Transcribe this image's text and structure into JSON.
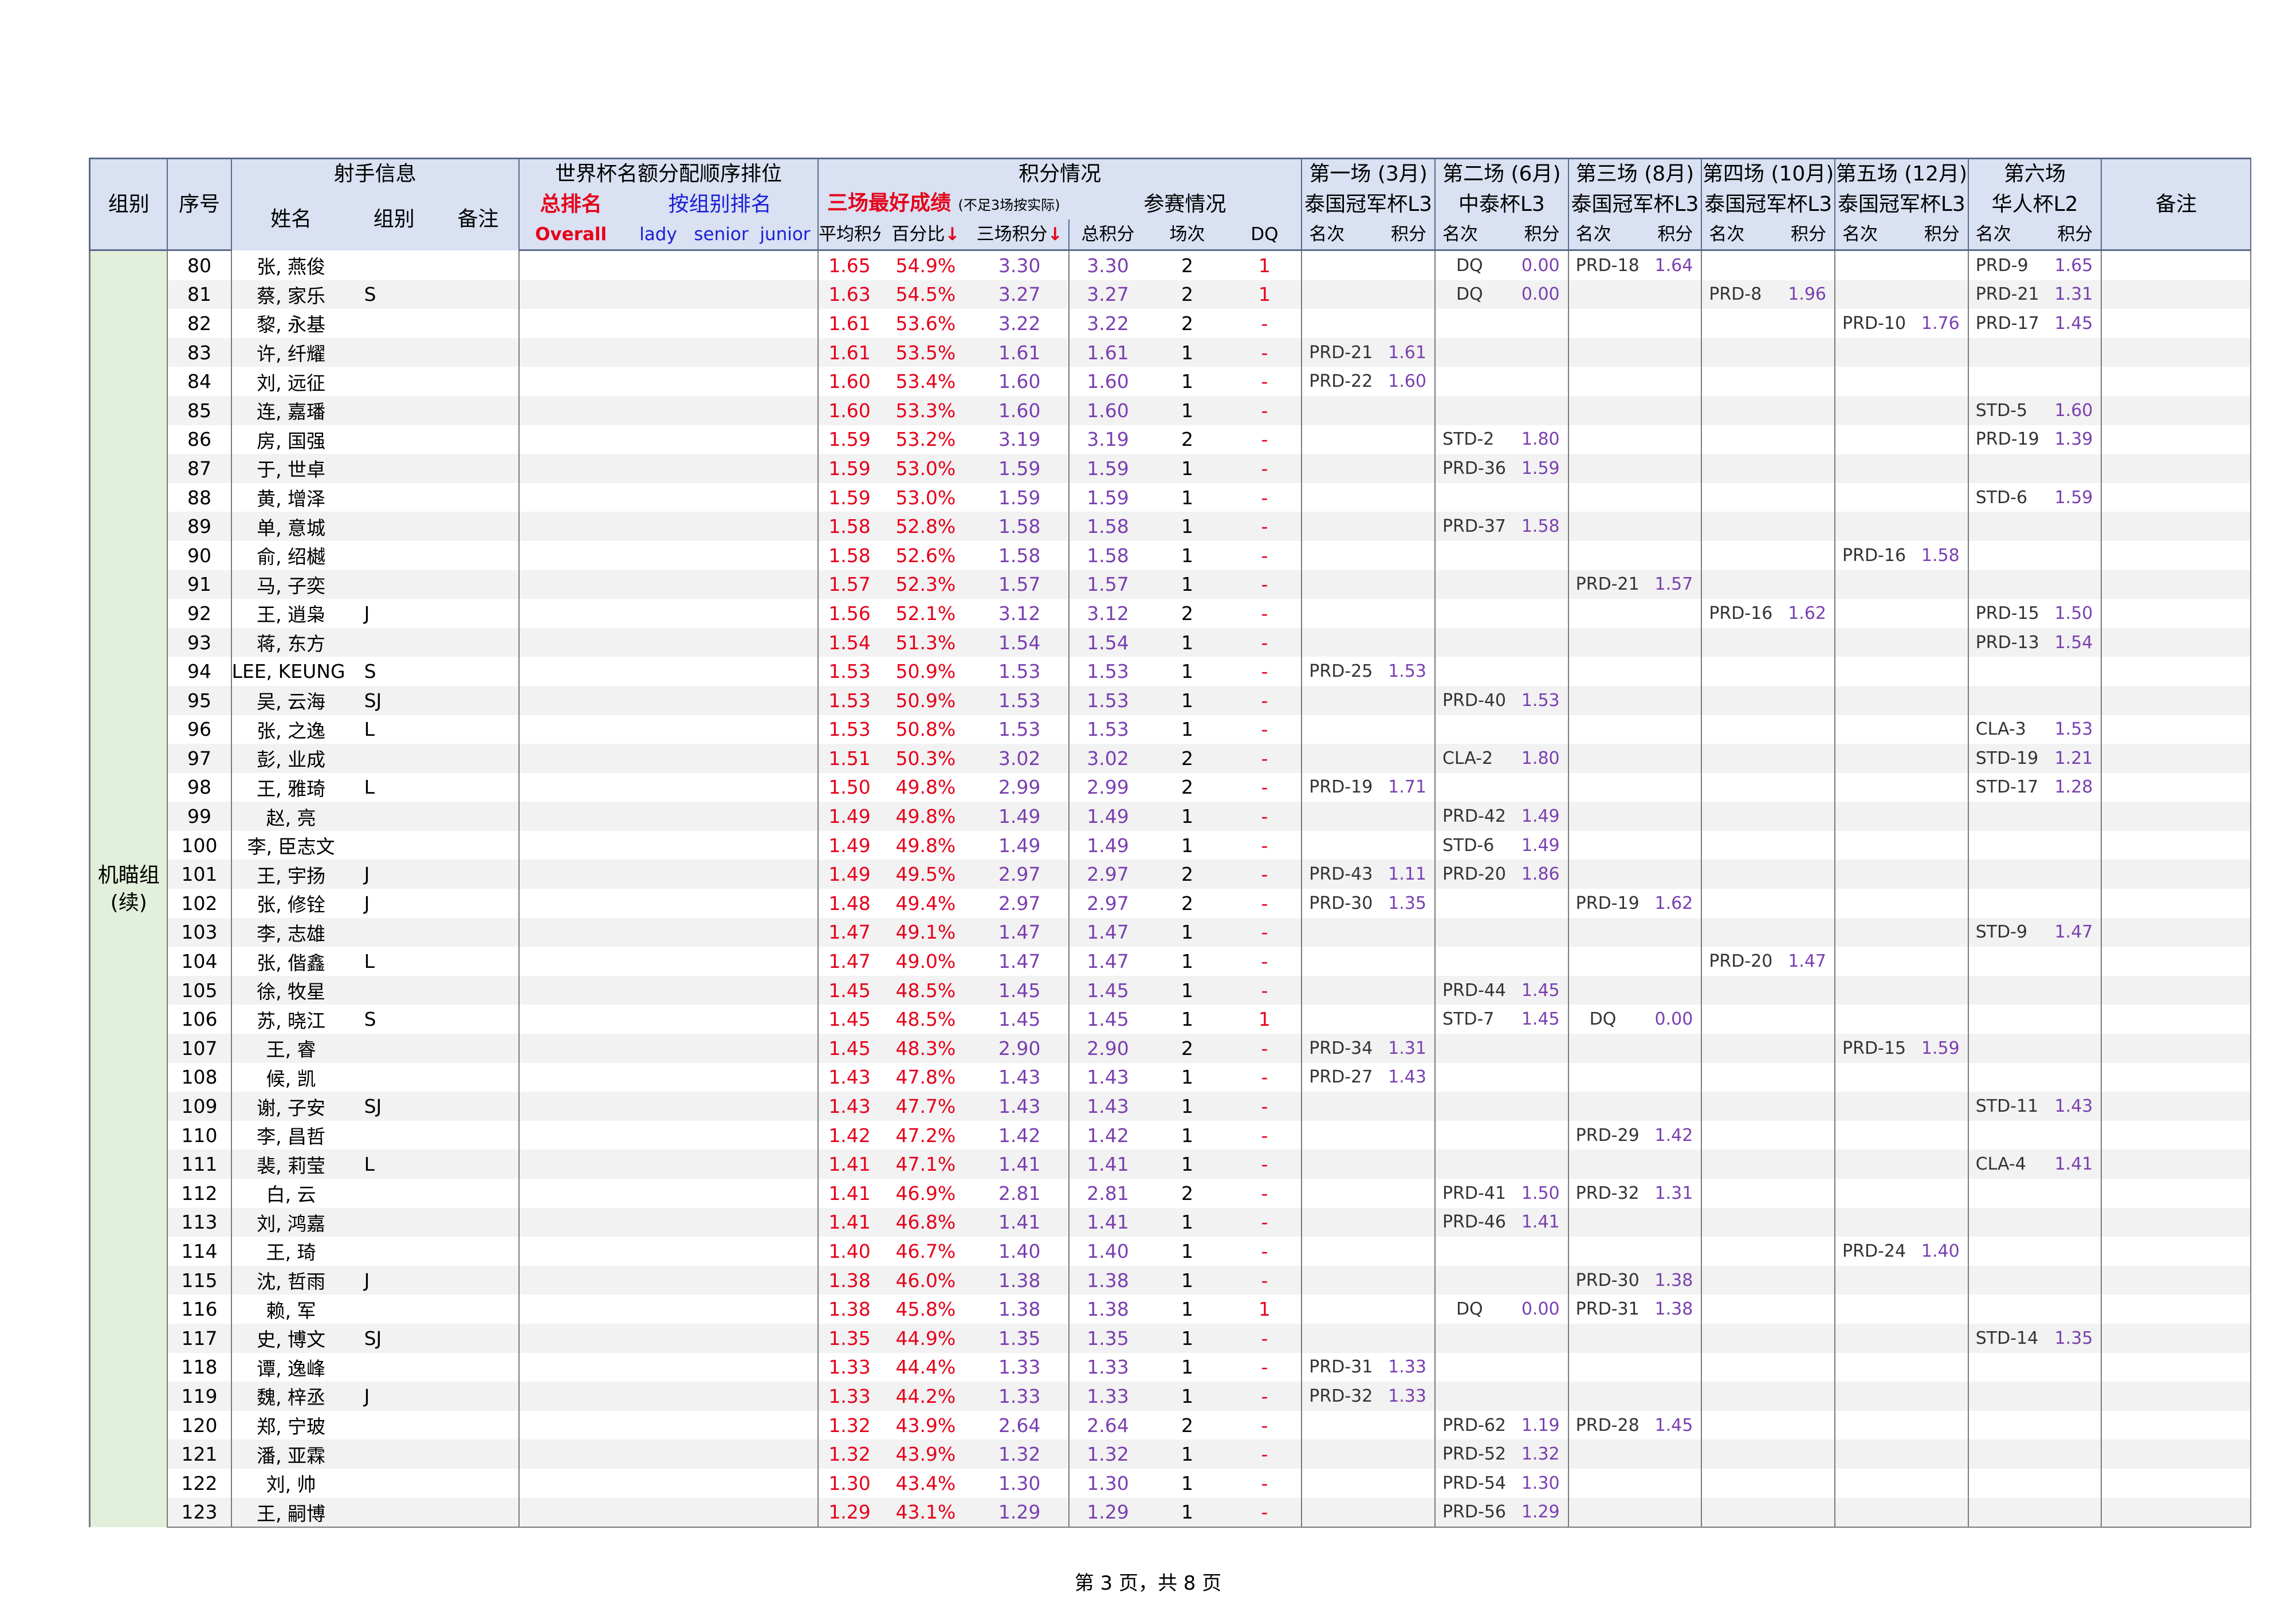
{
  "header": {
    "group": "组别",
    "seq": "序号",
    "shooter_info": "射手信息",
    "name": "姓名",
    "category": "组别",
    "remark_small": "备注",
    "wc_title": "世界杯名额分配顺序排位",
    "overall_cn": "总排名",
    "overall_en": "Overall",
    "by_group": "按组别排名",
    "lady": "lady",
    "senior": "senior",
    "junior": "junior",
    "score_title": "积分情况",
    "best3": "三场最好成绩",
    "best3_note": "(不足3场按实际)",
    "avg": "平均积分",
    "pct": "百分比",
    "three": "三场积分",
    "arrow": "↓",
    "participation": "参赛情况",
    "total": "总积分",
    "count": "场次",
    "dq": "DQ",
    "rank": "名次",
    "pts": "积分",
    "remark": "备注",
    "events": [
      {
        "title": "第一场 (3月)",
        "name": "泰国冠军杯L3"
      },
      {
        "title": "第二场 (6月)",
        "name": "中泰杯L3"
      },
      {
        "title": "第三场 (8月)",
        "name": "泰国冠军杯L3"
      },
      {
        "title": "第四场 (10月)",
        "name": "泰国冠军杯L3"
      },
      {
        "title": "第五场 (12月)",
        "name": "泰国冠军杯L3"
      },
      {
        "title": "第六场",
        "name": "华人杯L2"
      }
    ]
  },
  "group_label": "机瞄组 (续)",
  "rows": [
    {
      "no": "80",
      "name": "张, 燕俊",
      "tag": "",
      "avg": "1.65",
      "pct": "54.9%",
      "three": "3.30",
      "total": "3.30",
      "n": "2",
      "dq": "1",
      "e": [
        null,
        [
          "DQ",
          "0.00"
        ],
        [
          "PRD-18",
          "1.64"
        ],
        null,
        null,
        [
          "PRD-9",
          "1.65"
        ]
      ]
    },
    {
      "no": "81",
      "name": "蔡, 家乐",
      "tag": "S",
      "avg": "1.63",
      "pct": "54.5%",
      "three": "3.27",
      "total": "3.27",
      "n": "2",
      "dq": "1",
      "e": [
        null,
        [
          "DQ",
          "0.00"
        ],
        null,
        [
          "PRD-8",
          "1.96"
        ],
        null,
        [
          "PRD-21",
          "1.31"
        ]
      ]
    },
    {
      "no": "82",
      "name": "黎, 永基",
      "tag": "",
      "avg": "1.61",
      "pct": "53.6%",
      "three": "3.22",
      "total": "3.22",
      "n": "2",
      "dq": "-",
      "e": [
        null,
        null,
        null,
        null,
        [
          "PRD-10",
          "1.76"
        ],
        [
          "PRD-17",
          "1.45"
        ]
      ]
    },
    {
      "no": "83",
      "name": "许, 纤耀",
      "tag": "",
      "avg": "1.61",
      "pct": "53.5%",
      "three": "1.61",
      "total": "1.61",
      "n": "1",
      "dq": "-",
      "e": [
        [
          "PRD-21",
          "1.61"
        ],
        null,
        null,
        null,
        null,
        null
      ]
    },
    {
      "no": "84",
      "name": "刘, 远征",
      "tag": "",
      "avg": "1.60",
      "pct": "53.4%",
      "three": "1.60",
      "total": "1.60",
      "n": "1",
      "dq": "-",
      "e": [
        [
          "PRD-22",
          "1.60"
        ],
        null,
        null,
        null,
        null,
        null
      ]
    },
    {
      "no": "85",
      "name": "连, 嘉璠",
      "tag": "",
      "avg": "1.60",
      "pct": "53.3%",
      "three": "1.60",
      "total": "1.60",
      "n": "1",
      "dq": "-",
      "e": [
        null,
        null,
        null,
        null,
        null,
        [
          "STD-5",
          "1.60"
        ]
      ]
    },
    {
      "no": "86",
      "name": "房, 国强",
      "tag": "",
      "avg": "1.59",
      "pct": "53.2%",
      "three": "3.19",
      "total": "3.19",
      "n": "2",
      "dq": "-",
      "e": [
        null,
        [
          "STD-2",
          "1.80"
        ],
        null,
        null,
        null,
        [
          "PRD-19",
          "1.39"
        ]
      ]
    },
    {
      "no": "87",
      "name": "于, 世卓",
      "tag": "",
      "avg": "1.59",
      "pct": "53.0%",
      "three": "1.59",
      "total": "1.59",
      "n": "1",
      "dq": "-",
      "e": [
        null,
        [
          "PRD-36",
          "1.59"
        ],
        null,
        null,
        null,
        null
      ]
    },
    {
      "no": "88",
      "name": "黄, 增泽",
      "tag": "",
      "avg": "1.59",
      "pct": "53.0%",
      "three": "1.59",
      "total": "1.59",
      "n": "1",
      "dq": "-",
      "e": [
        null,
        null,
        null,
        null,
        null,
        [
          "STD-6",
          "1.59"
        ]
      ]
    },
    {
      "no": "89",
      "name": "单, 意城",
      "tag": "",
      "avg": "1.58",
      "pct": "52.8%",
      "three": "1.58",
      "total": "1.58",
      "n": "1",
      "dq": "-",
      "e": [
        null,
        [
          "PRD-37",
          "1.58"
        ],
        null,
        null,
        null,
        null
      ]
    },
    {
      "no": "90",
      "name": "俞, 绍樾",
      "tag": "",
      "avg": "1.58",
      "pct": "52.6%",
      "three": "1.58",
      "total": "1.58",
      "n": "1",
      "dq": "-",
      "e": [
        null,
        null,
        null,
        null,
        [
          "PRD-16",
          "1.58"
        ],
        null
      ]
    },
    {
      "no": "91",
      "name": "马, 子奕",
      "tag": "",
      "avg": "1.57",
      "pct": "52.3%",
      "three": "1.57",
      "total": "1.57",
      "n": "1",
      "dq": "-",
      "e": [
        null,
        null,
        [
          "PRD-21",
          "1.57"
        ],
        null,
        null,
        null
      ]
    },
    {
      "no": "92",
      "name": "王, 逍枭",
      "tag": "J",
      "avg": "1.56",
      "pct": "52.1%",
      "three": "3.12",
      "total": "3.12",
      "n": "2",
      "dq": "-",
      "e": [
        null,
        null,
        null,
        [
          "PRD-16",
          "1.62"
        ],
        null,
        [
          "PRD-15",
          "1.50"
        ]
      ]
    },
    {
      "no": "93",
      "name": "蒋, 东方",
      "tag": "",
      "avg": "1.54",
      "pct": "51.3%",
      "three": "1.54",
      "total": "1.54",
      "n": "1",
      "dq": "-",
      "e": [
        null,
        null,
        null,
        null,
        null,
        [
          "PRD-13",
          "1.54"
        ]
      ]
    },
    {
      "no": "94",
      "name": "LEE, KEUNG CHI",
      "tag": "S",
      "avg": "1.53",
      "pct": "50.9%",
      "three": "1.53",
      "total": "1.53",
      "n": "1",
      "dq": "-",
      "e": [
        [
          "PRD-25",
          "1.53"
        ],
        null,
        null,
        null,
        null,
        null
      ]
    },
    {
      "no": "95",
      "name": "吴, 云海",
      "tag": "SJ",
      "avg": "1.53",
      "pct": "50.9%",
      "three": "1.53",
      "total": "1.53",
      "n": "1",
      "dq": "-",
      "e": [
        null,
        [
          "PRD-40",
          "1.53"
        ],
        null,
        null,
        null,
        null
      ]
    },
    {
      "no": "96",
      "name": "张, 之逸",
      "tag": "L",
      "avg": "1.53",
      "pct": "50.8%",
      "three": "1.53",
      "total": "1.53",
      "n": "1",
      "dq": "-",
      "e": [
        null,
        null,
        null,
        null,
        null,
        [
          "CLA-3",
          "1.53"
        ]
      ]
    },
    {
      "no": "97",
      "name": "彭, 业成",
      "tag": "",
      "avg": "1.51",
      "pct": "50.3%",
      "three": "3.02",
      "total": "3.02",
      "n": "2",
      "dq": "-",
      "e": [
        null,
        [
          "CLA-2",
          "1.80"
        ],
        null,
        null,
        null,
        [
          "STD-19",
          "1.21"
        ]
      ]
    },
    {
      "no": "98",
      "name": "王, 雅琦",
      "tag": "L",
      "avg": "1.50",
      "pct": "49.8%",
      "three": "2.99",
      "total": "2.99",
      "n": "2",
      "dq": "-",
      "e": [
        [
          "PRD-19",
          "1.71"
        ],
        null,
        null,
        null,
        null,
        [
          "STD-17",
          "1.28"
        ]
      ]
    },
    {
      "no": "99",
      "name": "赵, 亮",
      "tag": "",
      "avg": "1.49",
      "pct": "49.8%",
      "three": "1.49",
      "total": "1.49",
      "n": "1",
      "dq": "-",
      "e": [
        null,
        [
          "PRD-42",
          "1.49"
        ],
        null,
        null,
        null,
        null
      ]
    },
    {
      "no": "100",
      "name": "李, 臣志文",
      "tag": "",
      "avg": "1.49",
      "pct": "49.8%",
      "three": "1.49",
      "total": "1.49",
      "n": "1",
      "dq": "-",
      "e": [
        null,
        [
          "STD-6",
          "1.49"
        ],
        null,
        null,
        null,
        null
      ]
    },
    {
      "no": "101",
      "name": "王, 宇扬",
      "tag": "J",
      "avg": "1.49",
      "pct": "49.5%",
      "three": "2.97",
      "total": "2.97",
      "n": "2",
      "dq": "-",
      "e": [
        [
          "PRD-43",
          "1.11"
        ],
        [
          "PRD-20",
          "1.86"
        ],
        null,
        null,
        null,
        null
      ]
    },
    {
      "no": "102",
      "name": "张, 修铨",
      "tag": "J",
      "avg": "1.48",
      "pct": "49.4%",
      "three": "2.97",
      "total": "2.97",
      "n": "2",
      "dq": "-",
      "e": [
        [
          "PRD-30",
          "1.35"
        ],
        null,
        [
          "PRD-19",
          "1.62"
        ],
        null,
        null,
        null
      ]
    },
    {
      "no": "103",
      "name": "李, 志雄",
      "tag": "",
      "avg": "1.47",
      "pct": "49.1%",
      "three": "1.47",
      "total": "1.47",
      "n": "1",
      "dq": "-",
      "e": [
        null,
        null,
        null,
        null,
        null,
        [
          "STD-9",
          "1.47"
        ]
      ]
    },
    {
      "no": "104",
      "name": "张, 偕鑫",
      "tag": "L",
      "avg": "1.47",
      "pct": "49.0%",
      "three": "1.47",
      "total": "1.47",
      "n": "1",
      "dq": "-",
      "e": [
        null,
        null,
        null,
        [
          "PRD-20",
          "1.47"
        ],
        null,
        null
      ]
    },
    {
      "no": "105",
      "name": "徐, 牧星",
      "tag": "",
      "avg": "1.45",
      "pct": "48.5%",
      "three": "1.45",
      "total": "1.45",
      "n": "1",
      "dq": "-",
      "e": [
        null,
        [
          "PRD-44",
          "1.45"
        ],
        null,
        null,
        null,
        null
      ]
    },
    {
      "no": "106",
      "name": "苏, 晓江",
      "tag": "S",
      "avg": "1.45",
      "pct": "48.5%",
      "three": "1.45",
      "total": "1.45",
      "n": "1",
      "dq": "1",
      "e": [
        null,
        [
          "STD-7",
          "1.45"
        ],
        [
          "DQ",
          "0.00"
        ],
        null,
        null,
        null
      ]
    },
    {
      "no": "107",
      "name": "王, 睿",
      "tag": "",
      "avg": "1.45",
      "pct": "48.3%",
      "three": "2.90",
      "total": "2.90",
      "n": "2",
      "dq": "-",
      "e": [
        [
          "PRD-34",
          "1.31"
        ],
        null,
        null,
        null,
        [
          "PRD-15",
          "1.59"
        ],
        null
      ]
    },
    {
      "no": "108",
      "name": "候, 凯",
      "tag": "",
      "avg": "1.43",
      "pct": "47.8%",
      "three": "1.43",
      "total": "1.43",
      "n": "1",
      "dq": "-",
      "e": [
        [
          "PRD-27",
          "1.43"
        ],
        null,
        null,
        null,
        null,
        null
      ]
    },
    {
      "no": "109",
      "name": "谢, 子安",
      "tag": "SJ",
      "avg": "1.43",
      "pct": "47.7%",
      "three": "1.43",
      "total": "1.43",
      "n": "1",
      "dq": "-",
      "e": [
        null,
        null,
        null,
        null,
        null,
        [
          "STD-11",
          "1.43"
        ]
      ]
    },
    {
      "no": "110",
      "name": "李, 昌哲",
      "tag": "",
      "avg": "1.42",
      "pct": "47.2%",
      "three": "1.42",
      "total": "1.42",
      "n": "1",
      "dq": "-",
      "e": [
        null,
        null,
        [
          "PRD-29",
          "1.42"
        ],
        null,
        null,
        null
      ]
    },
    {
      "no": "111",
      "name": "裴, 莉莹",
      "tag": "L",
      "avg": "1.41",
      "pct": "47.1%",
      "three": "1.41",
      "total": "1.41",
      "n": "1",
      "dq": "-",
      "e": [
        null,
        null,
        null,
        null,
        null,
        [
          "CLA-4",
          "1.41"
        ]
      ]
    },
    {
      "no": "112",
      "name": "白, 云",
      "tag": "",
      "avg": "1.41",
      "pct": "46.9%",
      "three": "2.81",
      "total": "2.81",
      "n": "2",
      "dq": "-",
      "e": [
        null,
        [
          "PRD-41",
          "1.50"
        ],
        [
          "PRD-32",
          "1.31"
        ],
        null,
        null,
        null
      ]
    },
    {
      "no": "113",
      "name": "刘, 鸿嘉",
      "tag": "",
      "avg": "1.41",
      "pct": "46.8%",
      "three": "1.41",
      "total": "1.41",
      "n": "1",
      "dq": "-",
      "e": [
        null,
        [
          "PRD-46",
          "1.41"
        ],
        null,
        null,
        null,
        null
      ]
    },
    {
      "no": "114",
      "name": "王, 琦",
      "tag": "",
      "avg": "1.40",
      "pct": "46.7%",
      "three": "1.40",
      "total": "1.40",
      "n": "1",
      "dq": "-",
      "e": [
        null,
        null,
        null,
        null,
        [
          "PRD-24",
          "1.40"
        ],
        null
      ]
    },
    {
      "no": "115",
      "name": "沈, 哲雨",
      "tag": "J",
      "avg": "1.38",
      "pct": "46.0%",
      "three": "1.38",
      "total": "1.38",
      "n": "1",
      "dq": "-",
      "e": [
        null,
        null,
        [
          "PRD-30",
          "1.38"
        ],
        null,
        null,
        null
      ]
    },
    {
      "no": "116",
      "name": "赖, 军",
      "tag": "",
      "avg": "1.38",
      "pct": "45.8%",
      "three": "1.38",
      "total": "1.38",
      "n": "1",
      "dq": "1",
      "e": [
        null,
        [
          "DQ",
          "0.00"
        ],
        [
          "PRD-31",
          "1.38"
        ],
        null,
        null,
        null
      ]
    },
    {
      "no": "117",
      "name": "史, 博文",
      "tag": "SJ",
      "avg": "1.35",
      "pct": "44.9%",
      "three": "1.35",
      "total": "1.35",
      "n": "1",
      "dq": "-",
      "e": [
        null,
        null,
        null,
        null,
        null,
        [
          "STD-14",
          "1.35"
        ]
      ]
    },
    {
      "no": "118",
      "name": "谭, 逸峰",
      "tag": "",
      "avg": "1.33",
      "pct": "44.4%",
      "three": "1.33",
      "total": "1.33",
      "n": "1",
      "dq": "-",
      "e": [
        [
          "PRD-31",
          "1.33"
        ],
        null,
        null,
        null,
        null,
        null
      ]
    },
    {
      "no": "119",
      "name": "魏, 梓丞",
      "tag": "J",
      "avg": "1.33",
      "pct": "44.2%",
      "three": "1.33",
      "total": "1.33",
      "n": "1",
      "dq": "-",
      "e": [
        [
          "PRD-32",
          "1.33"
        ],
        null,
        null,
        null,
        null,
        null
      ]
    },
    {
      "no": "120",
      "name": "郑, 宁玻",
      "tag": "",
      "avg": "1.32",
      "pct": "43.9%",
      "three": "2.64",
      "total": "2.64",
      "n": "2",
      "dq": "-",
      "e": [
        null,
        [
          "PRD-62",
          "1.19"
        ],
        [
          "PRD-28",
          "1.45"
        ],
        null,
        null,
        null
      ]
    },
    {
      "no": "121",
      "name": "潘, 亚霖",
      "tag": "",
      "avg": "1.32",
      "pct": "43.9%",
      "three": "1.32",
      "total": "1.32",
      "n": "1",
      "dq": "-",
      "e": [
        null,
        [
          "PRD-52",
          "1.32"
        ],
        null,
        null,
        null,
        null
      ]
    },
    {
      "no": "122",
      "name": "刘, 帅",
      "tag": "",
      "avg": "1.30",
      "pct": "43.4%",
      "three": "1.30",
      "total": "1.30",
      "n": "1",
      "dq": "-",
      "e": [
        null,
        [
          "PRD-54",
          "1.30"
        ],
        null,
        null,
        null,
        null
      ]
    },
    {
      "no": "123",
      "name": "王, 嗣博",
      "tag": "",
      "avg": "1.29",
      "pct": "43.1%",
      "three": "1.29",
      "total": "1.29",
      "n": "1",
      "dq": "-",
      "e": [
        null,
        [
          "PRD-56",
          "1.29"
        ],
        null,
        null,
        null,
        null
      ]
    }
  ],
  "footer": "第 3 页，共 8 页"
}
